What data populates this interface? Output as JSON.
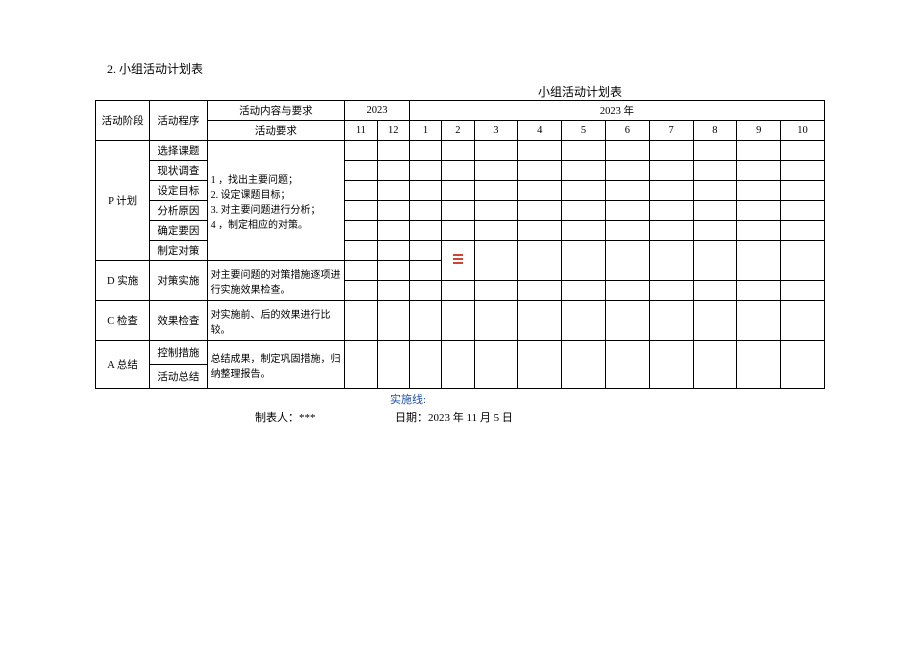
{
  "section_number": "2. 小组活动计划表",
  "table_title": "小组活动计划表",
  "header": {
    "stage": "活动阶段",
    "process": "活动程序",
    "content_req": "活动内容与要求",
    "req_sub": "活动要求",
    "year_a": "2023",
    "year_b": "2023 年",
    "months_a": [
      "11",
      "12"
    ],
    "months_b": [
      "1",
      "2",
      "3",
      "4",
      "5",
      "6",
      "7",
      "8",
      "9",
      "10"
    ]
  },
  "phases": {
    "p": {
      "label": "P 计划",
      "steps": [
        "选择课题",
        "现状调查",
        "设定目标",
        "分析原因",
        "确定要因",
        "制定对策"
      ],
      "req": "1            ，找出主要问题；\n2. 设定课题目标；\n3. 对主要问题进行分析；\n4            ，制定相应的对策。"
    },
    "d": {
      "label": "D 实施",
      "steps": [
        "对策实施"
      ],
      "req": "对主要问题的对策措施逐项进行实施效果检查。"
    },
    "c": {
      "label": "C 检查",
      "steps": [
        "效果检查"
      ],
      "req": "对实施前、后的效果进行比较。"
    },
    "a": {
      "label": "A 总结",
      "steps": [
        "控制措施",
        "活动总结"
      ],
      "req": "总结成果，制定巩固措施，归纳整理报告。"
    }
  },
  "footer": {
    "impl_line": "实施线:",
    "author_label": "制表人：***",
    "date_label": "日期：2023 年 11 月 5 日"
  }
}
